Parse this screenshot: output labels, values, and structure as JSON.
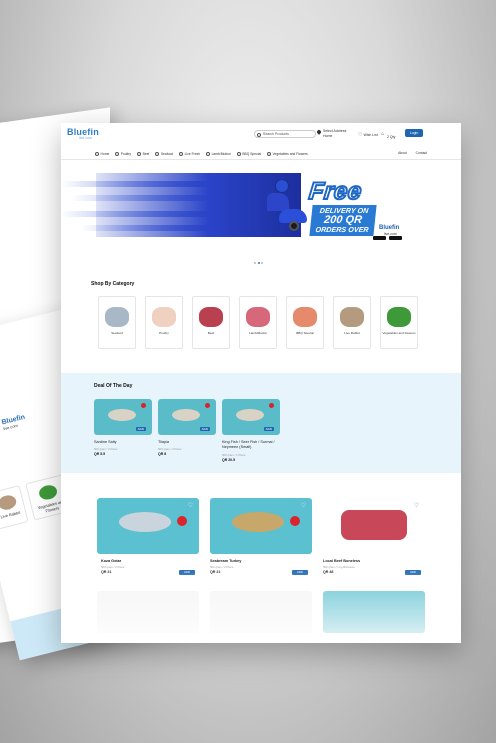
{
  "topbar": {
    "logo_main": "Bluefin",
    "logo_sub": "live.com",
    "search_placeholder": "Search Products",
    "address_label": "Select Address",
    "address_value": "Home",
    "wishlist_label": "Wish List",
    "cart_label": "Cart",
    "cart_qty": "2 Qty",
    "login_label": "Login"
  },
  "menu": {
    "items": [
      "Home",
      "Poultry",
      "Beef",
      "Seafood",
      "Live Fresh",
      "Lamb/Mutton",
      "BBQ Special",
      "Vegetables and Flowers"
    ],
    "right": [
      "About",
      "Contact"
    ]
  },
  "hero": {
    "headline": "Free",
    "line1": "DELIVERY ON",
    "line2": "200 QR",
    "line3": "ORDERS OVER",
    "brand": "Bluefin",
    "brand_sub": "live.com"
  },
  "categories": {
    "title": "Shop By Category",
    "items": [
      "Seafood",
      "Poultry",
      "Beef",
      "Lamb/Mutton",
      "BBQ Special",
      "Live Rabbit",
      "Vegetables and Flowers"
    ]
  },
  "deals": {
    "title": "Deal Of The Day",
    "items": [
      {
        "name": "Sardine Salty",
        "sub": "500 gram / 2 Piece",
        "price": "QR 5.5",
        "add": "ADD"
      },
      {
        "name": "Tilapia",
        "sub": "500 gram / 2 Piece",
        "price": "QR 8",
        "add": "ADD"
      },
      {
        "name": "King Fish / Seer Fish / Surmai / Neymeen (Small)",
        "sub": "500 gram / 1 Piece",
        "price": "QR 20.5",
        "add": "ADD"
      }
    ]
  },
  "products": [
    {
      "name": "Koza Gotar",
      "sub": "500 gram / 2 Piece",
      "price": "QR 21",
      "add": "ADD"
    },
    {
      "name": "Seabream Turkey",
      "sub": "500 gram / 2 Piece",
      "price": "QR 21",
      "add": "ADD"
    },
    {
      "name": "Local Beef Boneless",
      "sub": "500 gram / 1 kg Boneless",
      "price": "QR 48",
      "add": "ADD"
    }
  ],
  "colors": {
    "brand": "#1f66b0",
    "accent": "#2a7ad4",
    "card_teal": "#5bc0cf",
    "deal_bg": "#e8f4fc",
    "tomato": "#d9262e"
  },
  "mid_sheet": {
    "logo": "Bluefin",
    "logo_sub": "live.com",
    "cats": [
      "Live Rabbit",
      "Vegetables and Flowers"
    ]
  }
}
